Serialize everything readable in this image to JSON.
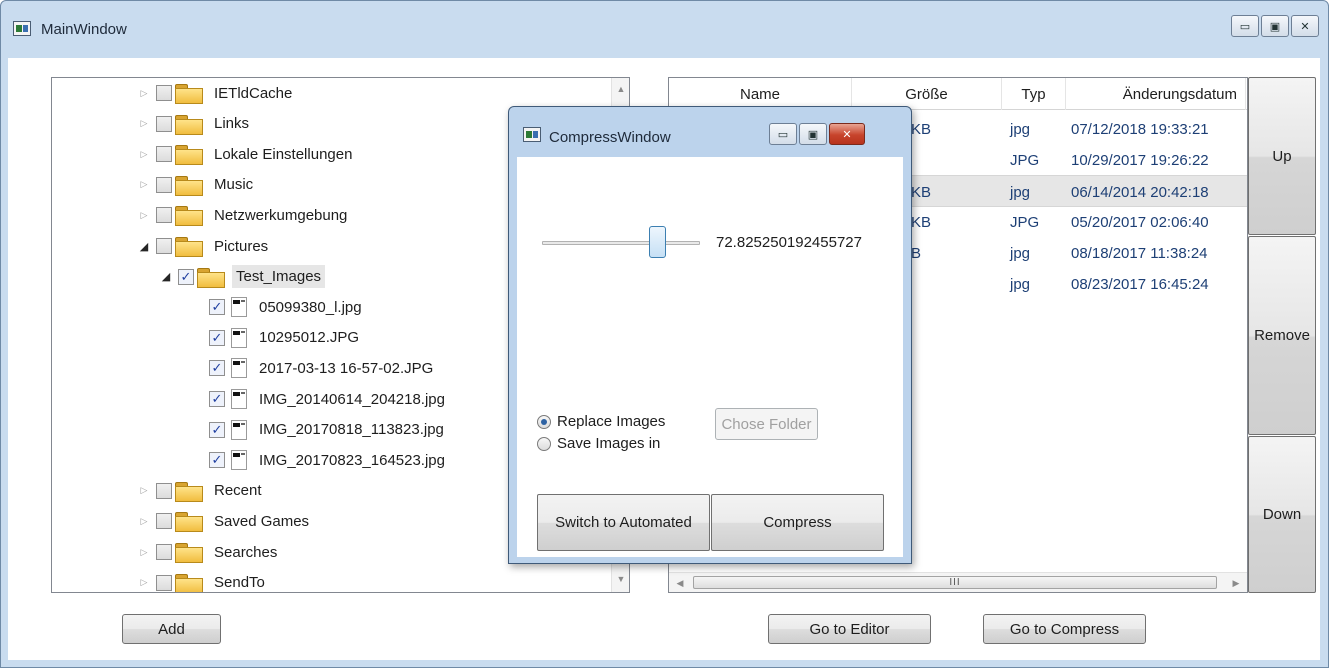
{
  "main_window": {
    "title": "MainWindow",
    "minimize_glyph": "▭",
    "maximize_glyph": "▣",
    "close_glyph": "✕"
  },
  "tree": {
    "items": [
      {
        "label": "IETldCache",
        "expanded": false,
        "checked": false,
        "kind": "folder"
      },
      {
        "label": "Links",
        "expanded": false,
        "checked": false,
        "kind": "folder"
      },
      {
        "label": "Lokale Einstellungen",
        "expanded": false,
        "checked": false,
        "kind": "folder"
      },
      {
        "label": "Music",
        "expanded": false,
        "checked": false,
        "kind": "folder"
      },
      {
        "label": "Netzwerkumgebung",
        "expanded": false,
        "checked": false,
        "kind": "folder"
      },
      {
        "label": "Pictures",
        "expanded": true,
        "checked": false,
        "kind": "folder"
      },
      {
        "label": "Test_Images",
        "expanded": true,
        "checked": true,
        "kind": "folder",
        "selected": true
      },
      {
        "label": "05099380_l.jpg",
        "checked": true,
        "kind": "file"
      },
      {
        "label": "10295012.JPG",
        "checked": true,
        "kind": "file"
      },
      {
        "label": "2017-03-13 16-57-02.JPG",
        "checked": true,
        "kind": "file"
      },
      {
        "label": "IMG_20140614_204218.jpg",
        "checked": true,
        "kind": "file"
      },
      {
        "label": "IMG_20170818_113823.jpg",
        "checked": true,
        "kind": "file"
      },
      {
        "label": "IMG_20170823_164523.jpg",
        "checked": true,
        "kind": "file"
      },
      {
        "label": "Recent",
        "expanded": false,
        "checked": false,
        "kind": "folder"
      },
      {
        "label": "Saved Games",
        "expanded": false,
        "checked": false,
        "kind": "folder"
      },
      {
        "label": "Searches",
        "expanded": false,
        "checked": false,
        "kind": "folder"
      },
      {
        "label": "SendTo",
        "expanded": false,
        "checked": false,
        "kind": "folder"
      }
    ],
    "collapsed_glyph": "▷",
    "expanded_glyph": "◢",
    "check_glyph": "✓"
  },
  "list": {
    "columns": [
      "Name",
      "Größe",
      "Typ",
      "Änderungsdatum"
    ],
    "rows": [
      {
        "size": "KB",
        "type": "jpg",
        "date": "07/12/2018 19:33:21",
        "selected": false
      },
      {
        "size": "",
        "type": "JPG",
        "date": "10/29/2017 19:26:22",
        "selected": false
      },
      {
        "size": "KB",
        "type": "jpg",
        "date": "06/14/2014 20:42:18",
        "selected": true
      },
      {
        "size": "KB",
        "type": "JPG",
        "date": "05/20/2017 02:06:40",
        "selected": false
      },
      {
        "size": "B",
        "type": "jpg",
        "date": "08/18/2017 11:38:24",
        "selected": false
      },
      {
        "size": "",
        "type": "jpg",
        "date": "08/23/2017 16:45:24",
        "selected": false
      }
    ],
    "scroll_thumb_grip": "III"
  },
  "side_buttons": {
    "up": "Up",
    "remove": "Remove",
    "down": "Down"
  },
  "bottom_buttons": {
    "add": "Add",
    "go_to_editor": "Go to Editor",
    "go_to_compress": "Go to Compress"
  },
  "compress_window": {
    "title": "CompressWindow",
    "slider_value": "72.825250192455727",
    "slider_fraction": 0.73,
    "radio_replace": "Replace Images",
    "radio_save": "Save Images in",
    "chose_folder": "Chose Folder",
    "switch_button": "Switch to Automated",
    "compress_button": "Compress"
  }
}
